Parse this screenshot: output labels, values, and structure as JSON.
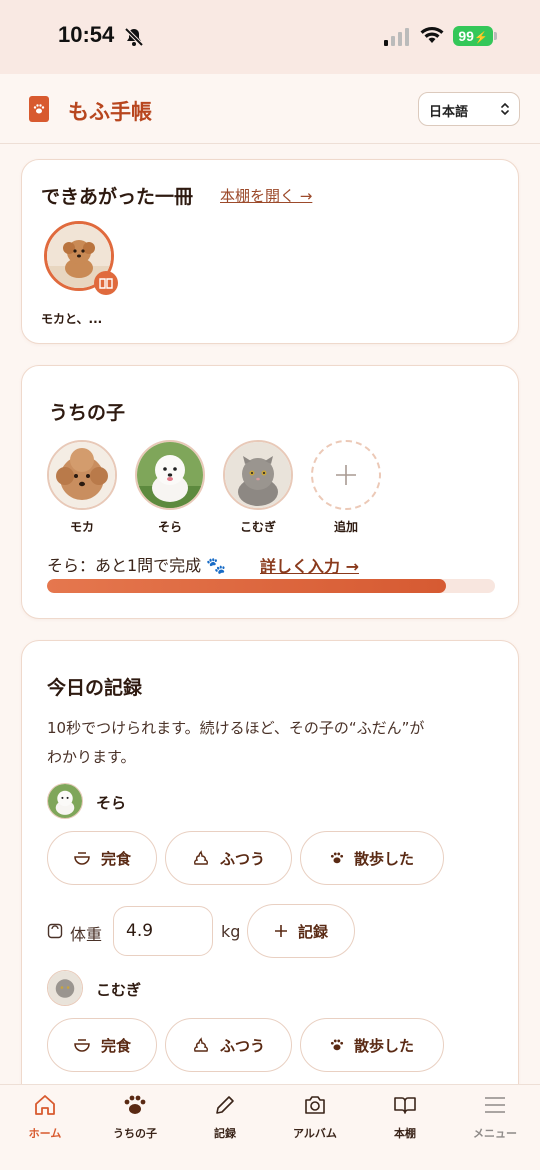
{
  "status": {
    "time": "10:54",
    "battery": "99"
  },
  "header": {
    "app_title": "もふ手帳",
    "language": "日本語"
  },
  "book_card": {
    "title": "できあがった一冊",
    "open_link": "本棚を開く →",
    "book_caption": "モカと、..."
  },
  "pets_card": {
    "title": "うちの子",
    "pets": [
      {
        "name": "モカ"
      },
      {
        "name": "そら"
      },
      {
        "name": "こむぎ"
      }
    ],
    "add_label": "追加",
    "progress_text": "そら：あと1問で完成 🐾",
    "progress_link": "詳しく入力 →",
    "progress": 0.89
  },
  "log_card": {
    "title": "今日の記録",
    "description_line1": "10秒でつけられます。続けるほど、その子の“ふだん”が",
    "description_line2": "わかります。",
    "entries": [
      {
        "pet_name": "そら",
        "chips": [
          "完食",
          "ふつう",
          "散歩した"
        ]
      },
      {
        "pet_name": "こむぎ",
        "chips": [
          "完食",
          "ふつう",
          "散歩した"
        ]
      }
    ],
    "weight_label": "体重",
    "weight_value": "4.9",
    "weight_unit": "kg",
    "record_button": "記録"
  },
  "tabs": [
    {
      "label": "ホーム",
      "icon": "home-icon"
    },
    {
      "label": "うちの子",
      "icon": "paw-icon"
    },
    {
      "label": "記録",
      "icon": "pencil-icon"
    },
    {
      "label": "アルバム",
      "icon": "camera-icon"
    },
    {
      "label": "本棚",
      "icon": "book-icon"
    },
    {
      "label": "メニュー",
      "icon": "menu-icon"
    }
  ],
  "colors": {
    "accent": "#d85a2f",
    "card_border": "#efd9cc",
    "background": "#fdf6f2"
  }
}
